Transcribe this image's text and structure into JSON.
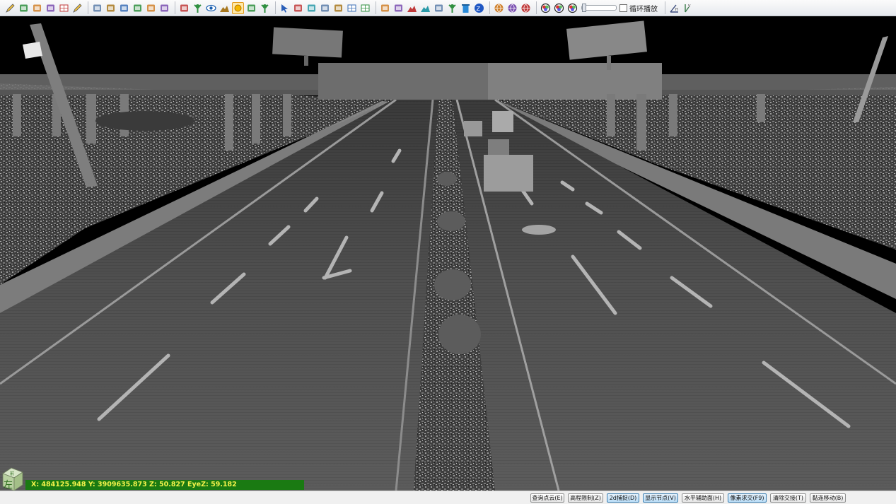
{
  "toolbar": {
    "icons": [
      "edit-pencil-icon",
      "save-icon",
      "layers-icon",
      "zoom-icon",
      "grid-panel-icon",
      "draw-pencil-icon",
      "window-copy-icon",
      "window-move-icon",
      "elevation-icon",
      "search-zoom-icon",
      "target-icon",
      "select-box-icon",
      "tools-icon",
      "tree-icon",
      "eye-icon",
      "terrain-icon",
      "sun-icon",
      "curve-icon",
      "fork-icon",
      "cursor-icon",
      "vector-edit-icon",
      "node-edit-icon",
      "image-edit-icon",
      "measure-icon",
      "ruler-icon",
      "grid-lines-icon",
      "polygon-icon",
      "surface-icon",
      "chart-icon",
      "mountain-icon",
      "cut-icon",
      "plant-icon",
      "delete-icon",
      "z-axis-icon",
      "globe-icon",
      "globe-color-icon",
      "globe-green-icon",
      "rgb-circle-icon",
      "rgb-circle-2-icon",
      "rgb-circle-3-icon"
    ],
    "loop_play_label": "循环播放",
    "loop_play_checked": false,
    "section_icons": [
      "angle-icon",
      "vertical-icon"
    ]
  },
  "viewport": {
    "coords": "X: 484125.948 Y: 3909635.873 Z: 50.827 EyeZ: 59.182",
    "view_cube_label": "左",
    "view_cube_top_label": "前"
  },
  "statusbar": {
    "buttons": [
      {
        "id": "query-point",
        "label": "查询点云(E)",
        "on": false
      },
      {
        "id": "elevation-limit",
        "label": "高程限制(Z)",
        "on": false
      },
      {
        "id": "2d-capture",
        "label": "2d捕捉(D)",
        "on": true
      },
      {
        "id": "show-nodes",
        "label": "显示节点(V)",
        "on": true
      },
      {
        "id": "horizontal-assist",
        "label": "水平辅助面(H)",
        "on": false
      },
      {
        "id": "pixel-intersect",
        "label": "像素求交(F9)",
        "on": true
      },
      {
        "id": "clear-intersect",
        "label": "清除交接(T)",
        "on": false
      },
      {
        "id": "snap-move",
        "label": "黏连移动(B)",
        "on": false
      }
    ]
  },
  "colors": {
    "toolbar_bg": "#eef0f4",
    "viewport_bg": "#000000",
    "coords_bg": "#1a7a12",
    "coords_text": "#f2f24a",
    "active_toggle": "#b9dcf6"
  }
}
